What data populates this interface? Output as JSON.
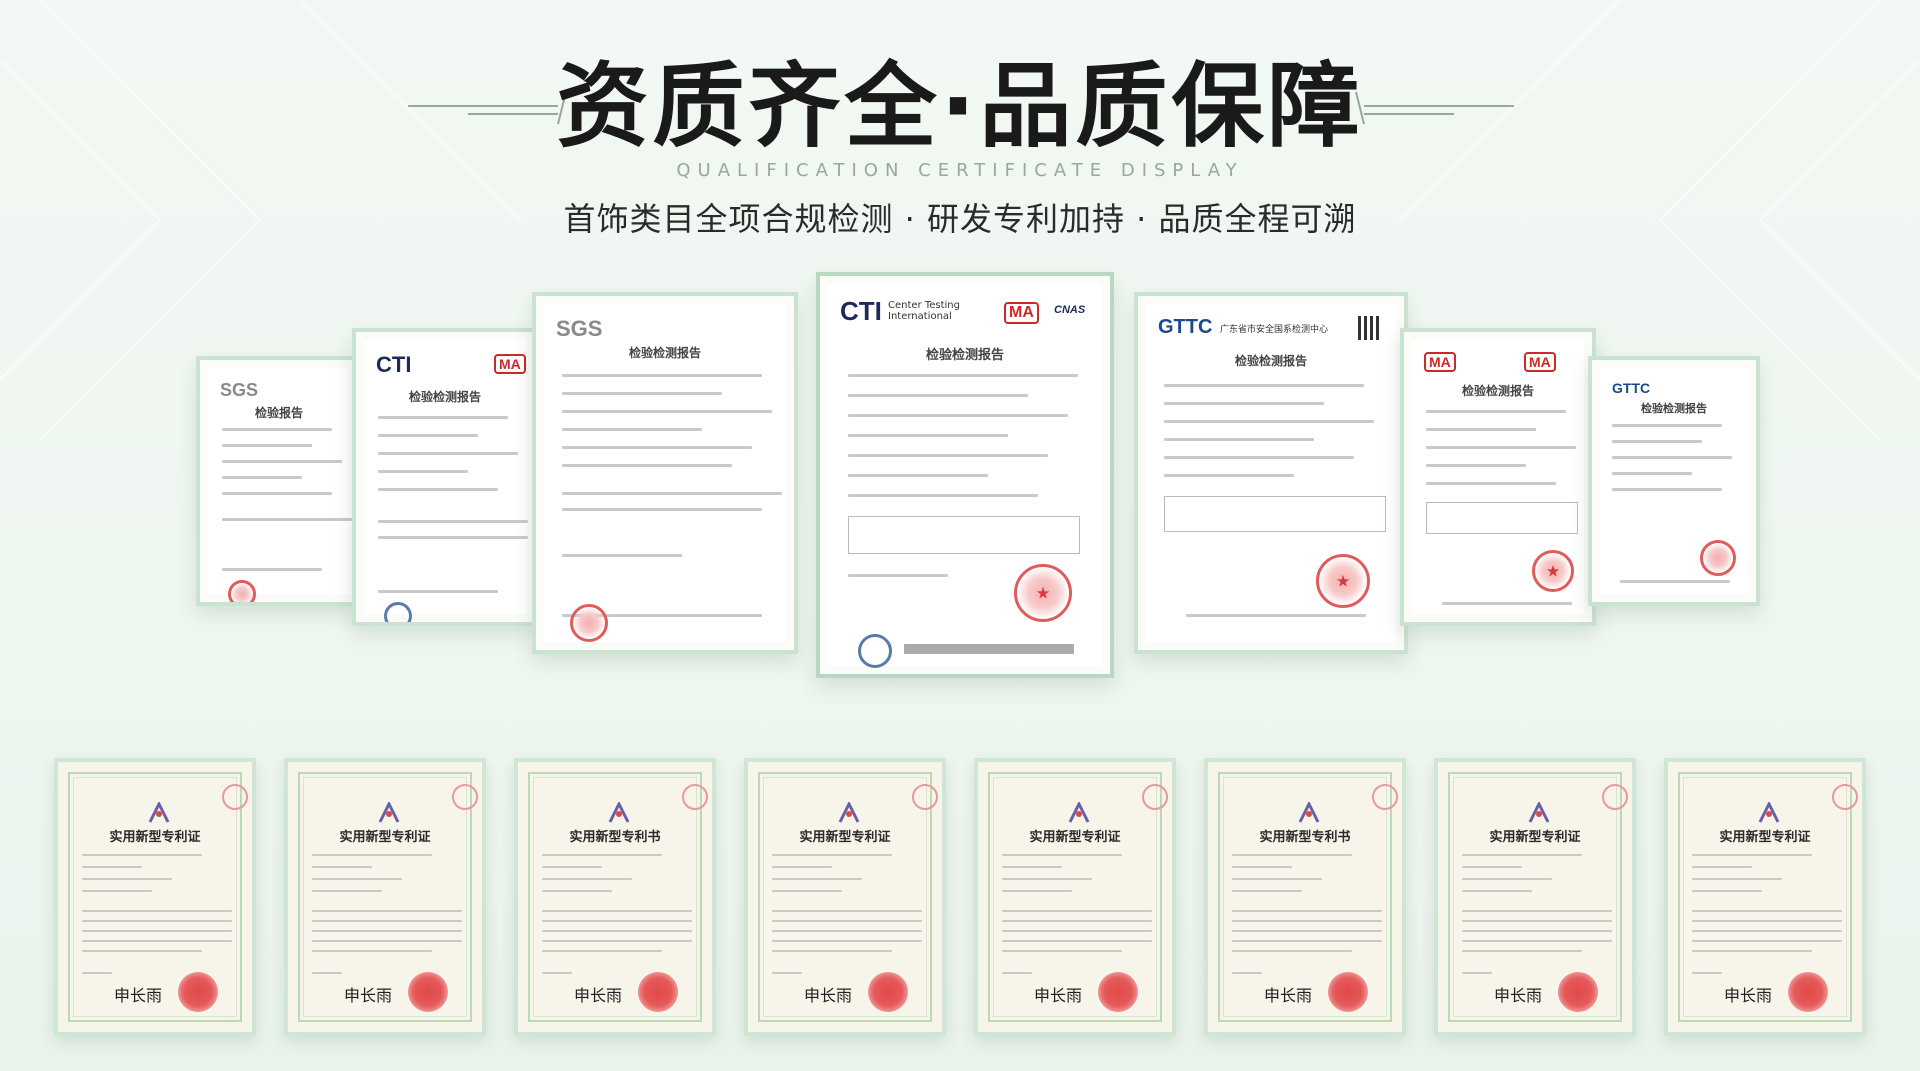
{
  "header": {
    "title": "资质齐全·品质保障",
    "subtitle_en": "QUALIFICATION CERTIFICATE DISPLAY",
    "tagline": "首饰类目全项合规检测 · 研发专利加持 · 品质全程可溯"
  },
  "certificates": [
    {
      "logo": "SGS",
      "title": "检验报告"
    },
    {
      "logo": "CTI",
      "badge": "MA",
      "title": "检验检测报告"
    },
    {
      "logo": "SGS",
      "title": "检验检测报告"
    },
    {
      "logo": "CTI",
      "logo_sub": "Center Testing International",
      "badge": "MA",
      "badge2": "CNAS",
      "title": "检验检测报告"
    },
    {
      "logo": "GTTC",
      "logo_sub": "广东省市安全国系检测中心",
      "title": "检验检测报告"
    },
    {
      "logo": "MA",
      "badge": "MA",
      "title": "检验检测报告"
    },
    {
      "logo": "GTTC",
      "title": "检验检测报告"
    }
  ],
  "patents": [
    {
      "title": "实用新型专利证"
    },
    {
      "title": "实用新型专利证"
    },
    {
      "title": "实用新型专利书"
    },
    {
      "title": "实用新型专利证"
    },
    {
      "title": "实用新型专利证"
    },
    {
      "title": "实用新型专利书"
    },
    {
      "title": "实用新型专利证"
    },
    {
      "title": "实用新型专利证"
    }
  ],
  "signature": "申长雨",
  "colors": {
    "accent_green": "#c9e3d0",
    "seal_red": "#e25b5b",
    "title_text": "#1a1a1a"
  }
}
